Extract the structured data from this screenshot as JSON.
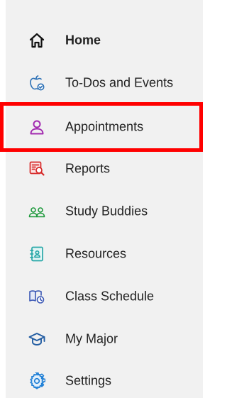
{
  "nav": {
    "items": [
      {
        "label": "Home",
        "icon": "home-icon",
        "color": "#111111"
      },
      {
        "label": "To-Dos and Events",
        "icon": "apple-check-icon",
        "color": "#2a6fb5"
      },
      {
        "label": "Appointments",
        "icon": "person-icon",
        "color": "#a22ab0"
      },
      {
        "label": "Reports",
        "icon": "report-search-icon",
        "color": "#d62828"
      },
      {
        "label": "Study Buddies",
        "icon": "users-icon",
        "color": "#1f9a3d"
      },
      {
        "label": "Resources",
        "icon": "contact-book-icon",
        "color": "#2aa8a8"
      },
      {
        "label": "Class Schedule",
        "icon": "book-clock-icon",
        "color": "#3b58b5"
      },
      {
        "label": "My Major",
        "icon": "graduation-cap-icon",
        "color": "#245ea3"
      },
      {
        "label": "Settings",
        "icon": "gear-icon",
        "color": "#1f7fd6"
      }
    ],
    "highlighted_item": "Appointments",
    "highlight_color": "#ff0000"
  }
}
